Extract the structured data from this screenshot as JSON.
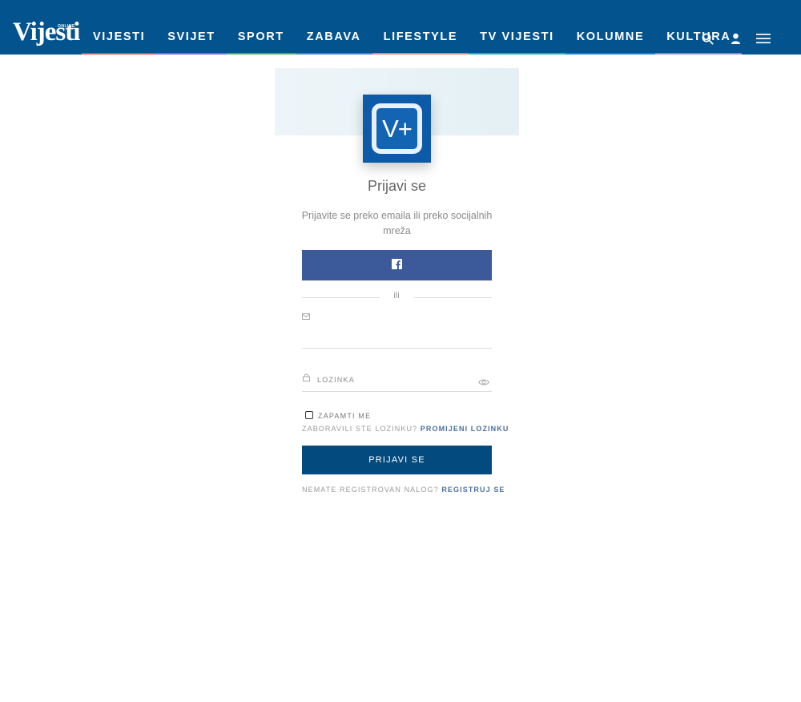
{
  "header": {
    "logo_text": "Vijesti",
    "logo_small": "ONLINE",
    "nav": [
      {
        "label": "VIJESTI",
        "color": "#e0534a"
      },
      {
        "label": "SVIJET",
        "color": "#6b6fd6"
      },
      {
        "label": "SPORT",
        "color": "#4caf50"
      },
      {
        "label": "ZABAVA",
        "color": "#3f82d6"
      },
      {
        "label": "LIFESTYLE",
        "color": "#e9826c"
      },
      {
        "label": "TV VIJESTI",
        "color": "#19b6b0"
      },
      {
        "label": "KOLUMNE",
        "color": "#1f7fd4"
      },
      {
        "label": "KULTURA",
        "color": "#9a86c9"
      }
    ],
    "icons": [
      "search-icon",
      "user-icon",
      "menu-icon"
    ]
  },
  "login": {
    "app_icon_text": "V+",
    "title": "Prijavi se",
    "subtitle": "Prijavite se preko emaila ili preko socijalnih mreža",
    "divider": "ili",
    "email_placeholder": "",
    "password_placeholder": "LOZINKA",
    "remember_label": "ZAPAMTI ME",
    "forgot_text": "ZABORAVILI STE LOZINKU?",
    "forgot_link": "PROMIJENI LOZINKU",
    "login_button": "PRIJAVI SE",
    "register_text": "NEMATE REGISTROVAN NALOG?",
    "register_link": "REGISTRUJ SE"
  },
  "colors": {
    "header_bg": "#03538e",
    "facebook": "#3c5a99",
    "primary_button": "#034a7e"
  }
}
